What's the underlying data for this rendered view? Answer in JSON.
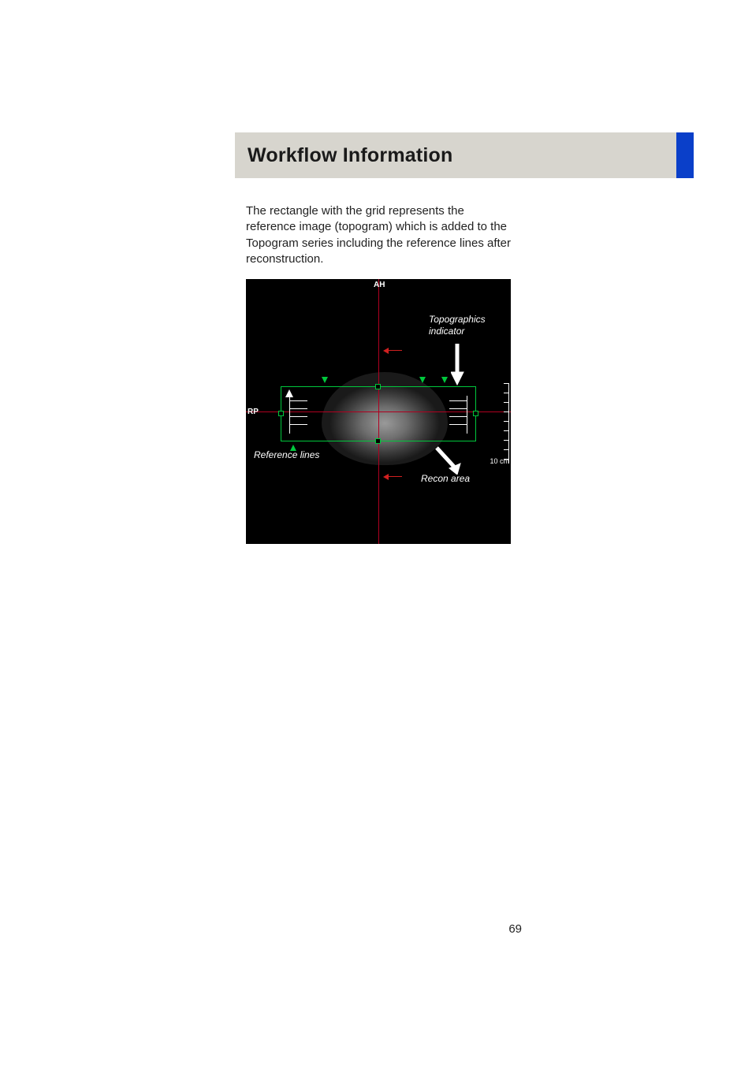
{
  "header": {
    "title": "Workflow Information"
  },
  "body": {
    "paragraph": "The rectangle with the grid represents the reference image (topogram) which is added to the Topogram series including the reference lines after reconstruction."
  },
  "figure": {
    "top_center_label": "AH",
    "left_label": "RP",
    "scale_label": "10 cm",
    "callouts": {
      "topographics_line1": "Topographics",
      "topographics_line2": "indicator",
      "reference_lines": "Reference lines",
      "recon_area": "Recon  area"
    }
  },
  "page_number": "69"
}
